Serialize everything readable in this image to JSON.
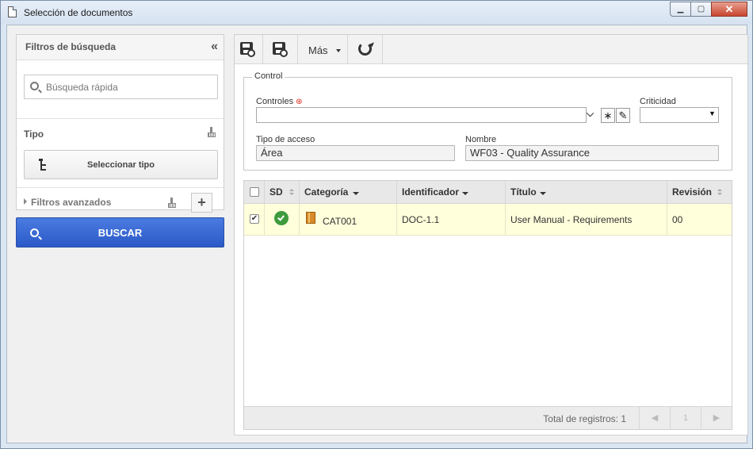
{
  "window": {
    "title": "Selección de documentos"
  },
  "filters": {
    "title": "Filtros de búsqueda",
    "quick_search_placeholder": "Búsqueda rápida",
    "type_label": "Tipo",
    "select_type_label": "Seleccionar tipo",
    "advanced_label": "Filtros avanzados",
    "search_button_label": "BUSCAR"
  },
  "toolbar": {
    "more_label": "Más"
  },
  "control": {
    "legend": "Control",
    "controls_label": "Controles",
    "controls_value": "",
    "criticality_label": "Criticidad",
    "criticality_value": "",
    "access_type_label": "Tipo de acceso",
    "access_type_value": "Área",
    "name_label": "Nombre",
    "name_value": "WF03 - Quality Assurance"
  },
  "grid": {
    "columns": [
      "SD",
      "Categoría",
      "Identificador",
      "Título",
      "Revisión"
    ],
    "rows": [
      {
        "checked": true,
        "sd": "approved",
        "category": "CAT001",
        "identifier": "DOC-1.1",
        "title": "User Manual - Requirements",
        "revision": "00"
      }
    ],
    "total_label": "Total de registros: 1",
    "page": "1"
  },
  "colors": {
    "accent": "#2f5fcc",
    "selected_row": "#ffffdc",
    "sd_ok": "#3d9b3d"
  }
}
